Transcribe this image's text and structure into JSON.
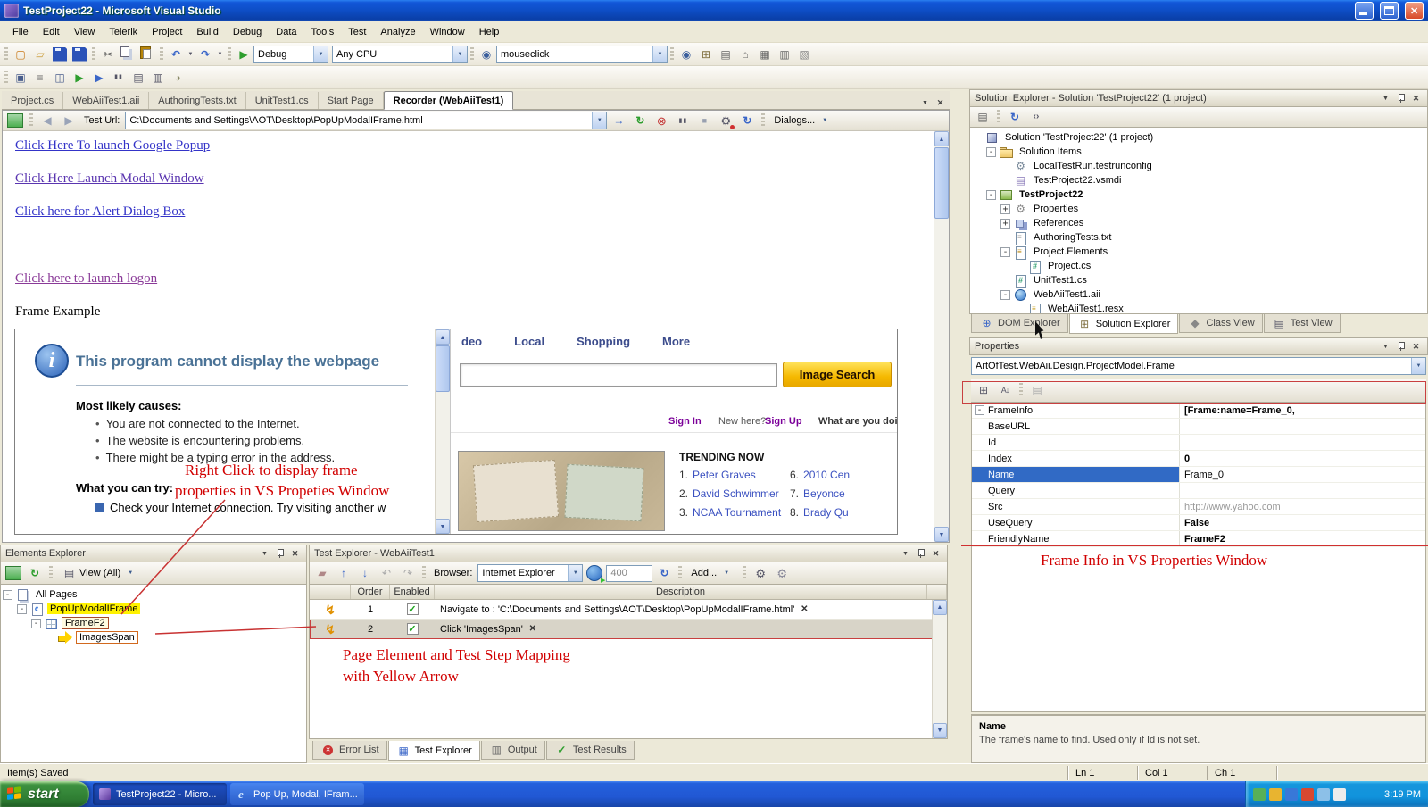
{
  "colors": {
    "titlebar_blue": "#0E4FC8",
    "panel_beige": "#ECE9D8",
    "selection_blue": "#316AC5",
    "annotation_red": "#D10000",
    "highlight_yellow": "#FFF200",
    "image_search_yellow": "#F5B800",
    "taskbar_blue": "#245EDC",
    "start_green": "#2E7D32"
  },
  "window": {
    "title": "TestProject22 - Microsoft Visual Studio"
  },
  "menu": {
    "items": [
      "File",
      "Edit",
      "View",
      "Telerik",
      "Project",
      "Build",
      "Debug",
      "Data",
      "Tools",
      "Test",
      "Analyze",
      "Window",
      "Help"
    ]
  },
  "toolbar1": {
    "icons_left": [
      "new-project",
      "open-file",
      "save",
      "save-all"
    ],
    "icons_edit": [
      "cut",
      "copy",
      "paste"
    ],
    "debug": "Debug",
    "platform": "Any CPU",
    "search": "mouseclick",
    "icons_right": [
      "find",
      "solution-explorer",
      "properties-window",
      "object-browser",
      "toolbox",
      "command-window",
      "other-windows"
    ]
  },
  "toolbar2": {
    "icons": [
      "new-test",
      "ordered-test",
      "unit-test",
      "run-tests",
      "debug-tests",
      "pause-tests",
      "test-view",
      "test-list",
      "code-coverage"
    ]
  },
  "doc_tabs": [
    {
      "label": "Project.cs"
    },
    {
      "label": "WebAiiTest1.aii"
    },
    {
      "label": "AuthoringTests.txt"
    },
    {
      "label": "UnitTest1.cs"
    },
    {
      "label": "Start Page"
    },
    {
      "label": "Recorder (WebAiiTest1)",
      "active": true
    }
  ],
  "recorder": {
    "test_url_label": "Test Url:",
    "test_url": "C:\\Documents and Settings\\AOT\\Desktop\\PopUpModalIFrame.html",
    "dialogs_button": "Dialogs...",
    "page": {
      "links": [
        {
          "text": "Click Here To launch Google Popup"
        },
        {
          "text": "Click Here Launch Modal Window"
        },
        {
          "text": "Click here for Alert Dialog Box"
        },
        {
          "text": "Click here to launch logon"
        }
      ],
      "frame_label": "Frame Example",
      "ie_error": {
        "title": "This program cannot display the webpage",
        "causes_title": "Most likely causes:",
        "causes": [
          {
            "text": "You are not connected to the Internet."
          },
          {
            "text": "The website is encountering problems."
          },
          {
            "text": "There might be a typing error in the address."
          }
        ],
        "try_title": "What you can try:",
        "try_text": "Check your Internet connection. Try visiting another w"
      },
      "yahoo": {
        "nav": [
          {
            "label": "deo"
          },
          {
            "label": "Local"
          },
          {
            "label": "Shopping"
          },
          {
            "label": "More"
          }
        ],
        "image_search_button": "Image Search",
        "sign_in": "Sign In",
        "new_here": "New here?",
        "sign_up": "Sign Up",
        "doing": "What are you doing'",
        "trending_title": "TRENDING NOW",
        "trending_col1": [
          {
            "num": "1.",
            "name": "Peter Graves"
          },
          {
            "num": "2.",
            "name": "David Schwimmer"
          },
          {
            "num": "3.",
            "name": "NCAA Tournament"
          }
        ],
        "trending_col2": [
          {
            "num": "6.",
            "name": "2010 Cen"
          },
          {
            "num": "7.",
            "name": "Beyonce"
          },
          {
            "num": "8.",
            "name": "Brady Qu"
          }
        ]
      }
    }
  },
  "elements_explorer": {
    "title": "Elements Explorer",
    "view_button": "View (All)",
    "tree": [
      {
        "label": "All Pages",
        "indent": 0,
        "exp": "-",
        "icon": "pages"
      },
      {
        "label": "PopUpModalIFrame",
        "indent": 1,
        "exp": "-",
        "icon": "page-ie",
        "highlight": true
      },
      {
        "label": "FrameF2",
        "indent": 2,
        "exp": "-",
        "icon": "frame",
        "boxed_red": true
      },
      {
        "label": "ImagesSpan",
        "indent": 3,
        "icon": "yellow-arrow",
        "boxed_orange": true
      }
    ]
  },
  "test_explorer": {
    "title": "Test Explorer - WebAiiTest1",
    "browser_label": "Browser:",
    "browser": "Internet Explorer",
    "speed": "400",
    "add_button": "Add...",
    "columns": {
      "order": "Order",
      "enabled": "Enabled",
      "description": "Description"
    },
    "steps": [
      {
        "order": "1",
        "enabled": true,
        "description": "Navigate to : 'C:\\Documents and Settings\\AOT\\Desktop\\PopUpModalIFrame.html'"
      },
      {
        "order": "2",
        "enabled": true,
        "description": "Click 'ImagesSpan'",
        "selected": true
      }
    ]
  },
  "bottom_tabs": [
    {
      "label": "Error List",
      "icon": "error-list"
    },
    {
      "label": "Test Explorer",
      "icon": "test-explorer-tab",
      "active": true
    },
    {
      "label": "Output",
      "icon": "output"
    },
    {
      "label": "Test Results",
      "icon": "test-results"
    }
  ],
  "solution_explorer": {
    "title": "Solution Explorer - Solution 'TestProject22' (1 project)",
    "tree": [
      {
        "label": "Solution 'TestProject22' (1 project)",
        "indent": 0,
        "icon": "solution"
      },
      {
        "label": "Solution Items",
        "indent": 1,
        "exp": "-",
        "icon": "folder"
      },
      {
        "label": "LocalTestRun.testrunconfig",
        "indent": 2,
        "icon": "config"
      },
      {
        "label": "TestProject22.vsmdi",
        "indent": 2,
        "icon": "vsmdi"
      },
      {
        "label": "TestProject22",
        "indent": 1,
        "exp": "-",
        "icon": "project",
        "bold": true
      },
      {
        "label": "Properties",
        "indent": 2,
        "exp": "+",
        "icon": "props"
      },
      {
        "label": "References",
        "indent": 2,
        "exp": "+",
        "icon": "refs"
      },
      {
        "label": "AuthoringTests.txt",
        "indent": 2,
        "icon": "txt"
      },
      {
        "label": "Project.Elements",
        "indent": 2,
        "exp": "-",
        "icon": "elements"
      },
      {
        "label": "Project.cs",
        "indent": 3,
        "icon": "cs"
      },
      {
        "label": "UnitTest1.cs",
        "indent": 2,
        "icon": "cs"
      },
      {
        "label": "WebAiiTest1.aii",
        "indent": 2,
        "exp": "-",
        "icon": "aii"
      },
      {
        "label": "WebAiiTest1.resx",
        "indent": 3,
        "icon": "resx"
      }
    ]
  },
  "right_tabs": [
    {
      "label": "DOM Explorer",
      "icon": "dom-explorer"
    },
    {
      "label": "Solution Explorer",
      "icon": "solution-tab",
      "active": true
    },
    {
      "label": "Class View",
      "icon": "class-view"
    },
    {
      "label": "Test View",
      "icon": "test-view-tab"
    }
  ],
  "properties": {
    "title": "Properties",
    "selected_object": "ArtOfTest.WebAii.Design.ProjectModel.Frame",
    "rows": [
      {
        "name": "FrameInfo",
        "value": "[Frame:name=Frame_0,",
        "exp": "-",
        "bold_value": true
      },
      {
        "name": "BaseURL",
        "value": ""
      },
      {
        "name": "Id",
        "value": ""
      },
      {
        "name": "Index",
        "value": "0",
        "bold_value": true
      },
      {
        "name": "Name",
        "value": "Frame_0",
        "selected": true,
        "caret": true
      },
      {
        "name": "Query",
        "value": ""
      },
      {
        "name": "Src",
        "value": "http://www.yahoo.com",
        "muted": true
      },
      {
        "name": "UseQuery",
        "value": "False",
        "bold_value": true
      },
      {
        "name": "FriendlyName",
        "value": "FrameF2",
        "bold_value": true
      }
    ],
    "description": {
      "title": "Name",
      "text": "The frame's name to find. Used only if Id is not set."
    }
  },
  "annotations": {
    "right_click_line1": "Right Click to display frame",
    "right_click_line2": "properties in VS Propeties Window",
    "mapping_line1": "Page Element and Test Step Mapping",
    "mapping_line2": "with Yellow Arrow",
    "frame_info": "Frame Info in VS Properties Window"
  },
  "status_bar": {
    "message": "Item(s) Saved",
    "ln": "Ln 1",
    "col": "Col 1",
    "ch": "Ch 1"
  },
  "taskbar": {
    "start_label": "start",
    "tasks": [
      {
        "label": "TestProject22 - Micro...",
        "icon": "vs"
      },
      {
        "label": "Pop Up, Modal, IFram...",
        "icon": "ie"
      }
    ],
    "clock": "3:19 PM"
  }
}
